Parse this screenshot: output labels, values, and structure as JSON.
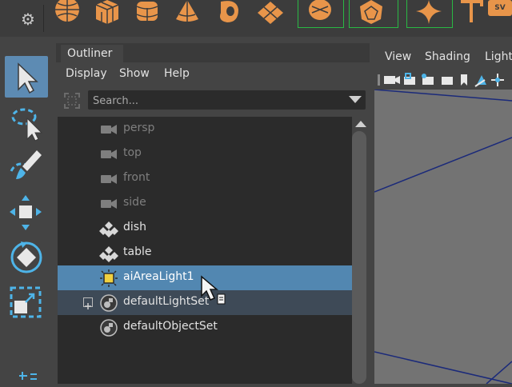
{
  "outliner": {
    "tab_title": "Outliner",
    "menu": [
      "Display",
      "Show",
      "Help"
    ],
    "search": {
      "placeholder": "Search...",
      "value": ""
    },
    "rows": [
      {
        "label": "persp",
        "icon": "camera-icon",
        "state": "dim"
      },
      {
        "label": "top",
        "icon": "camera-icon",
        "state": "dim"
      },
      {
        "label": "front",
        "icon": "camera-icon",
        "state": "dim"
      },
      {
        "label": "side",
        "icon": "camera-icon",
        "state": "dim"
      },
      {
        "label": "dish",
        "icon": "mesh-icon",
        "state": "normal"
      },
      {
        "label": "table",
        "icon": "mesh-icon",
        "state": "normal"
      },
      {
        "label": "aiAreaLight1",
        "icon": "area-light-icon",
        "state": "selected"
      },
      {
        "label": "defaultLightSet",
        "icon": "set-icon",
        "state": "hover",
        "expandable": true
      },
      {
        "label": "defaultObjectSet",
        "icon": "set-icon",
        "state": "normal"
      }
    ]
  },
  "viewport": {
    "menu": [
      "View",
      "Shading",
      "Light"
    ]
  },
  "colors": {
    "selection": "#5287b1",
    "shelf_icon": "#e8954a",
    "tool_active": "#5d8bb3",
    "tool_icon": "#4eb4e8",
    "bracket": "#29b944",
    "grid_line": "#1b2a7a"
  }
}
